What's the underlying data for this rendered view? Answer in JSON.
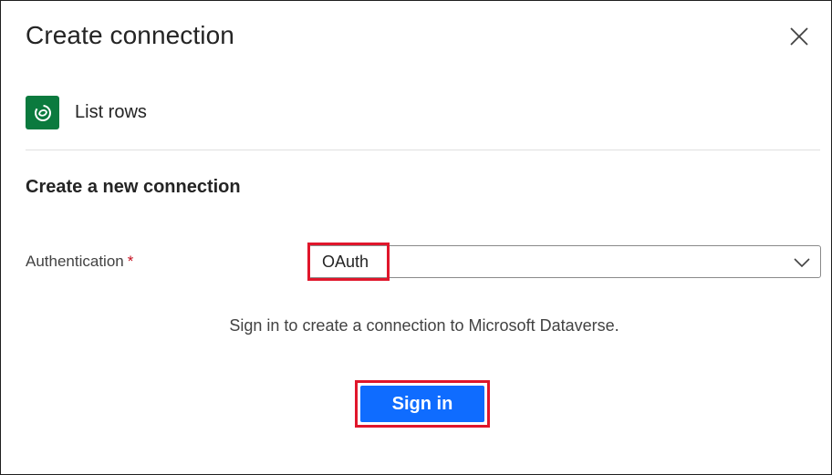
{
  "dialog": {
    "title": "Create connection",
    "close_icon": "close-icon"
  },
  "action": {
    "icon": "dataverse-icon",
    "icon_color": "#0b7a3e",
    "name": "List rows"
  },
  "form": {
    "heading": "Create a new connection",
    "authentication": {
      "label": "Authentication",
      "required_marker": "*",
      "value": "OAuth",
      "chevron_icon": "chevron-down-icon"
    },
    "info": "Sign in to create a connection to Microsoft Dataverse.",
    "sign_in_label": "Sign in"
  },
  "colors": {
    "primary": "#0f6cff",
    "highlight": "#e0162b",
    "required": "#c50f1f"
  }
}
